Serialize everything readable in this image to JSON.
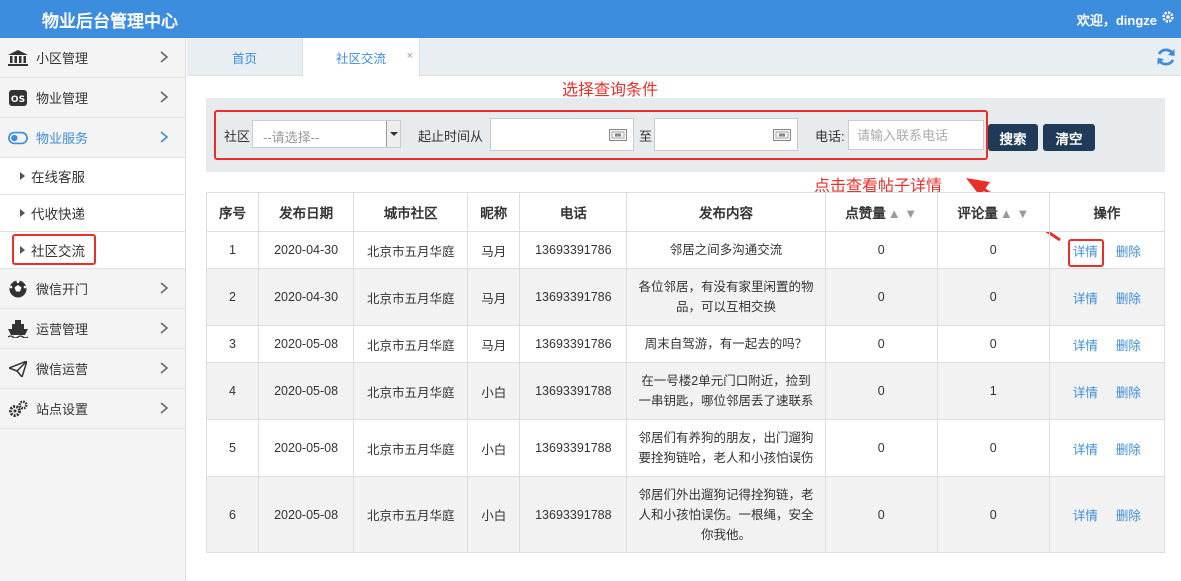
{
  "header": {
    "title": "物业后台管理中心",
    "welcome": "欢迎，dingze"
  },
  "sidebar": {
    "items": [
      {
        "label": "小区管理",
        "icon": "bank-icon"
      },
      {
        "label": "物业管理",
        "icon": "os-icon"
      },
      {
        "label": "物业服务",
        "icon": "toggle-icon"
      },
      {
        "label": "在线客服"
      },
      {
        "label": "代收快递"
      },
      {
        "label": "社区交流"
      },
      {
        "label": "微信开门",
        "icon": "soccer-icon"
      },
      {
        "label": "运营管理",
        "icon": "ship-icon"
      },
      {
        "label": "微信运营",
        "icon": "paper-plane-icon"
      },
      {
        "label": "站点设置",
        "icon": "gears-icon"
      }
    ]
  },
  "tabs": [
    {
      "label": "首页"
    },
    {
      "label": "社区交流",
      "close": "×"
    }
  ],
  "annotations": {
    "search": "选择查询条件",
    "detail": "点击查看帖子详情"
  },
  "search": {
    "community_label": "社区",
    "community_value": "--请选择--",
    "date_label": "起止时间从",
    "to_label": "至",
    "phone_label": "电话:",
    "phone_placeholder": "请输入联系电话",
    "search_btn": "搜索",
    "clear_btn": "清空"
  },
  "table": {
    "headers": [
      "序号",
      "发布日期",
      "城市社区",
      "昵称",
      "电话",
      "发布内容",
      "点赞量",
      "评论量",
      "操作"
    ],
    "sort_glyphs": "▲ ▼",
    "detail_label": "详情",
    "delete_label": "删除",
    "rows": [
      {
        "no": "1",
        "date": "2020-04-30",
        "community": "北京市五月华庭",
        "nick": "马月",
        "phone": "13693391786",
        "content": "邻居之间多沟通交流",
        "likes": "0",
        "comments": "0"
      },
      {
        "no": "2",
        "date": "2020-04-30",
        "community": "北京市五月华庭",
        "nick": "马月",
        "phone": "13693391786",
        "content": "各位邻居，有没有家里闲置的物品，可以互相交换",
        "likes": "0",
        "comments": "0"
      },
      {
        "no": "3",
        "date": "2020-05-08",
        "community": "北京市五月华庭",
        "nick": "马月",
        "phone": "13693391786",
        "content": "周末自驾游，有一起去的吗？",
        "likes": "0",
        "comments": "0"
      },
      {
        "no": "4",
        "date": "2020-05-08",
        "community": "北京市五月华庭",
        "nick": "小白",
        "phone": "13693391788",
        "content": "在一号楼2单元门口附近，捡到一串钥匙，哪位邻居丢了速联系",
        "likes": "0",
        "comments": "1"
      },
      {
        "no": "5",
        "date": "2020-05-08",
        "community": "北京市五月华庭",
        "nick": "小白",
        "phone": "13693391788",
        "content": "邻居们有养狗的朋友，出门遛狗要拴狗链哈，老人和小孩怕误伤",
        "likes": "0",
        "comments": "0"
      },
      {
        "no": "6",
        "date": "2020-05-08",
        "community": "北京市五月华庭",
        "nick": "小白",
        "phone": "13693391788",
        "content": "邻居们外出遛狗记得拴狗链，老人和小孩怕误伤。一根绳，安全你我他。",
        "likes": "0",
        "comments": "0"
      }
    ]
  },
  "colors": {
    "header": "#3c8dde",
    "accent": "#3c8dde",
    "annotation": "#e8302a",
    "button": "#1f3b57"
  }
}
